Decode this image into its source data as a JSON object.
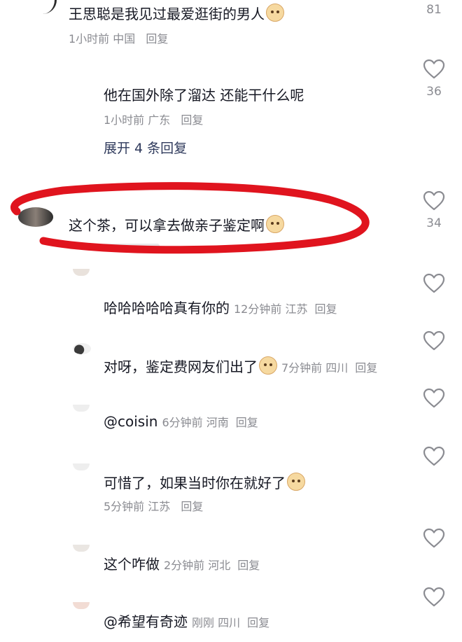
{
  "comments": [
    {
      "id": "c1",
      "text": "王思聪是我见过最爱逛街的男人",
      "time": "1小时前",
      "location": "中国",
      "reply": "回复",
      "likes": "81"
    },
    {
      "id": "c2",
      "text": "他在国外除了溜达 还能干什么呢",
      "time": "1小时前",
      "location": "广东",
      "reply": "回复",
      "likes": "36"
    },
    {
      "id": "c3",
      "text": "这个茶，可以拿去做亲子鉴定啊",
      "likes": "34"
    }
  ],
  "expand_label": "展开 4 条回复",
  "replies": [
    {
      "text": "哈哈哈哈哈真有你的",
      "time": "12分钟前",
      "location": "江苏",
      "reply": "回复"
    },
    {
      "text": "对呀，鉴定费网友们出了",
      "time": "7分钟前",
      "location": "四川",
      "reply": "回复"
    },
    {
      "text": "@coisin",
      "time": "6分钟前",
      "location": "河南",
      "reply": "回复"
    },
    {
      "text": "可惜了，如果当时你在就好了",
      "time": "5分钟前",
      "location": "江苏",
      "reply": "回复"
    },
    {
      "text": "这个咋做",
      "time": "2分钟前",
      "location": "河北",
      "reply": "回复"
    },
    {
      "text": "@希望有奇迹",
      "time": "刚刚",
      "location": "四川",
      "reply": "回复"
    }
  ],
  "colors": {
    "annotation": "#e0141e",
    "meta": "#8a8b91",
    "text": "#161823"
  },
  "icons": [
    "heart-outline-icon",
    "emoji-icon"
  ]
}
